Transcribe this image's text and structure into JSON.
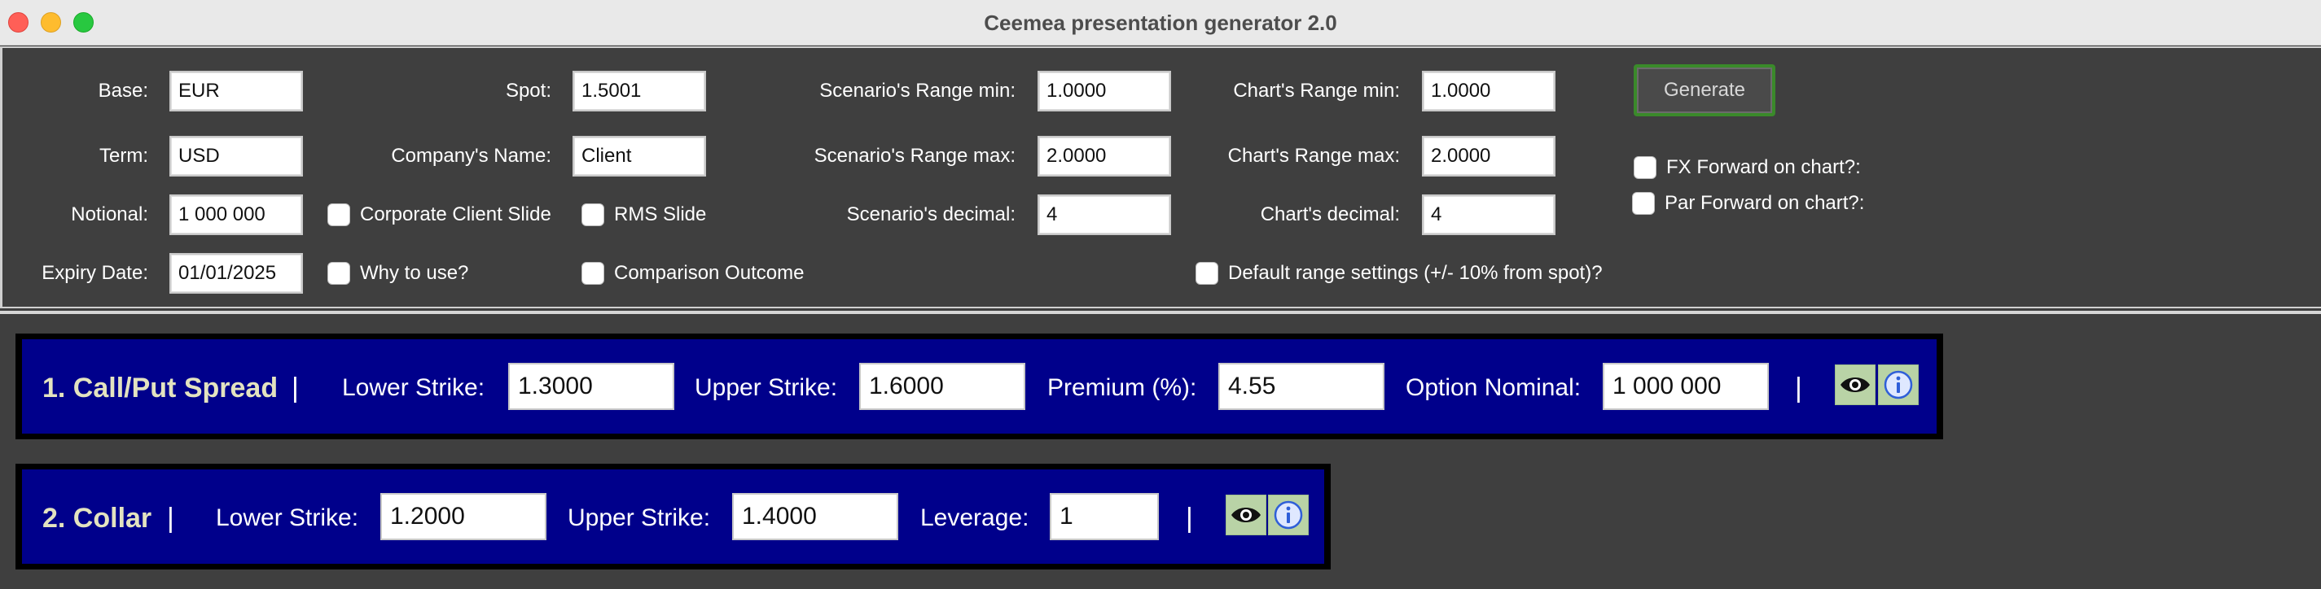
{
  "window": {
    "title": "Ceemea presentation generator 2.0"
  },
  "settings": {
    "base": {
      "label": "Base:",
      "value": "EUR"
    },
    "term": {
      "label": "Term:",
      "value": "USD"
    },
    "notional": {
      "label": "Notional:",
      "value": "1 000 000"
    },
    "expiry": {
      "label": "Expiry Date:",
      "value": "01/01/2025"
    },
    "spot": {
      "label": "Spot:",
      "value": "1.5001"
    },
    "company": {
      "label": "Company's Name:",
      "value": "Client"
    },
    "scenario_min": {
      "label": "Scenario's Range min:",
      "value": "1.0000"
    },
    "scenario_max": {
      "label": "Scenario's Range max:",
      "value": "2.0000"
    },
    "scenario_decimal": {
      "label": "Scenario's decimal:",
      "value": "4"
    },
    "chart_min": {
      "label": "Chart's Range min:",
      "value": "1.0000"
    },
    "chart_max": {
      "label": "Chart's Range max:",
      "value": "2.0000"
    },
    "chart_decimal": {
      "label": "Chart's decimal:",
      "value": "4"
    },
    "generate_label": "Generate",
    "checkboxes": {
      "corporate_client": "Corporate Client Slide",
      "rms": "RMS Slide",
      "why_to_use": "Why to use?",
      "comparison": "Comparison Outcome",
      "default_range": "Default range settings (+/- 10% from spot)?",
      "fx_forward": "FX Forward on chart?:",
      "par_forward": "Par Forward on chart?:"
    }
  },
  "strategies": [
    {
      "title": "1. Call/Put Spread",
      "separator": "|",
      "lower_label": "Lower Strike:",
      "lower_value": "1.3000",
      "upper_label": "Upper Strike:",
      "upper_value": "1.6000",
      "premium_label": "Premium (%):",
      "premium_value": "4.55",
      "nominal_label": "Option Nominal:",
      "nominal_value": "1 000 000",
      "end_separator": "|"
    },
    {
      "title": "2. Collar",
      "separator": "|",
      "lower_label": "Lower Strike:",
      "lower_value": "1.2000",
      "upper_label": "Upper Strike:",
      "upper_value": "1.4000",
      "leverage_label": "Leverage:",
      "leverage_value": "1",
      "end_separator": "|"
    }
  ],
  "icons": {
    "preview": "eye-icon",
    "info": "info-icon"
  },
  "colors": {
    "background": "#3f3f3f",
    "strategy_bar": "#00008b",
    "strategy_title": "#e3e3c0",
    "generate_border": "#3a8a2a",
    "icon_button": "#b9d3a6"
  }
}
